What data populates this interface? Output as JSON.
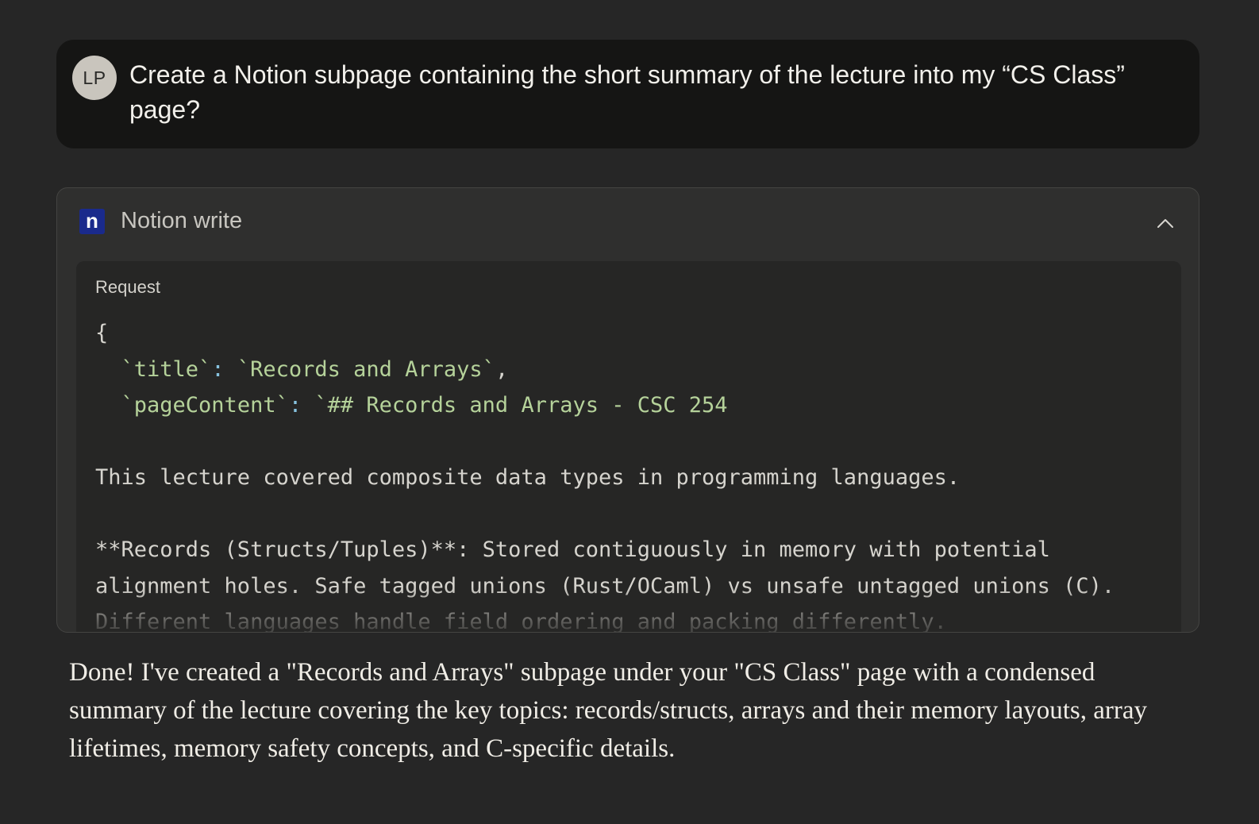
{
  "user_message": {
    "avatar_initials": "LP",
    "text": "Create a Notion subpage containing the short summary of the lecture into my “CS Class” page?"
  },
  "tool_call": {
    "icon": "notion-icon",
    "icon_letter": "n",
    "title": "Notion write",
    "expanded": true,
    "request_label": "Request",
    "code": {
      "open_brace": "{",
      "line_title_key": "`title`",
      "line_title_sep": ": ",
      "line_title_value": "`Records and Arrays`",
      "line_title_comma": ",",
      "line_content_key": "`pageContent`",
      "line_content_sep": ": ",
      "line_content_value": "`## Records and Arrays - CSC 254",
      "paragraph_1": "This lecture covered composite data types in programming languages.",
      "paragraph_2_line_1": "**Records (Structs/Tuples)**: Stored contiguously in memory with potential",
      "paragraph_2_line_2": "alignment holes. Safe tagged unions (Rust/OCaml) vs unsafe untagged unions (C).",
      "paragraph_2_line_3": "Different languages handle field ordering and packing differently."
    }
  },
  "assistant_reply": {
    "text": "Done! I've created a \"Records and Arrays\" subpage under your \"CS Class\" page with a condensed summary of the lecture covering the key topics: records/structs, arrays and their memory layouts, array lifetimes, memory safety concepts, and C-specific details."
  },
  "colors": {
    "background": "#262626",
    "user_bubble": "#151514",
    "tool_card": "#2f2f2e",
    "request_box": "#262625",
    "notion_icon_bg": "#1a2a8c",
    "code_string": "#b5d29a",
    "code_punctuation": "#87c3e0"
  }
}
